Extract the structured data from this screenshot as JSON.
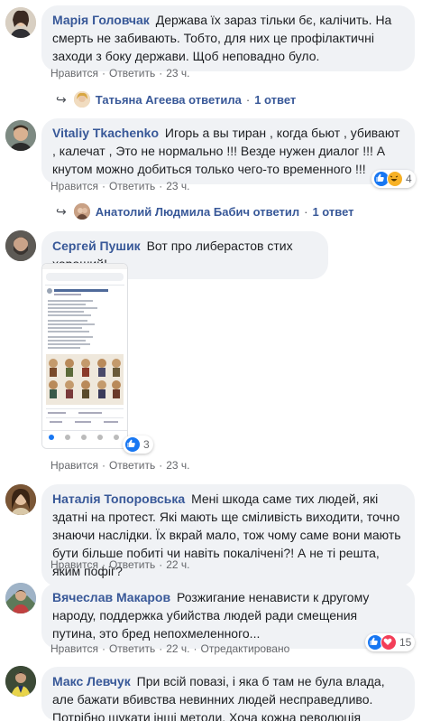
{
  "comments": [
    {
      "author": "Марія Головчак",
      "text": "Держава їх зараз тільки бє, калічить. На смерть не забивають. Тобто, для них це профілактичні заходи з боку держави. Щоб неповадно було.",
      "like": "Нравится",
      "reply": "Ответить",
      "time": "23 ч."
    },
    {
      "author": "Vitaliy Tkachenko",
      "text": "Игорь а вы тиран , когда бьют , убивают , калечат , Это не нормально !!! Везде нужен диалог !!! А кнутом можно добиться только чего-то временного !!!",
      "like": "Нравится",
      "reply": "Ответить",
      "time": "23 ч.",
      "reactions": "4"
    },
    {
      "author": "Сергей Пушик",
      "text": "Вот про либерастов стих хороший!",
      "like": "Нравится",
      "reply": "Ответить",
      "time": "23 ч.",
      "reactions": "3"
    },
    {
      "author": "Наталія Топоровська",
      "text": "Мені шкода саме тих людей, які здатні на протест. Які мають ще сміливість виходити, точно знаючи наслідки. Їх вкрай мало, тож чому саме вони мають бути більше побиті чи навіть покалічені?! А не ті решта, яким пофіг?",
      "like": "Нравится",
      "reply": "Ответить",
      "time": "22 ч."
    },
    {
      "author": "Вячеслав Макаров",
      "text": "Розжигание ненависти к другому народу, поддержка убийства людей ради смещения путина, это бред непохмеленного...",
      "like": "Нравится",
      "reply": "Ответить",
      "time": "22 ч.",
      "edited": "Отредактировано",
      "reactions": "15"
    },
    {
      "author": "Макс Левчук",
      "text": "При всій повазі, і яка б там не була влада, але бажати вбивства невинних людей несправедливо. Потрібно шукати інші методи. Хоча кожна революція потребує жертв."
    }
  ],
  "replies": [
    {
      "name": "Татьяна Агеева ответила",
      "count": "1 ответ"
    },
    {
      "name": "Анатолий Людмила Бабич ответил",
      "count": "1 ответ"
    }
  ],
  "colors": {
    "link": "#385898",
    "bubble": "#f0f2f5",
    "meta": "#65676b",
    "like": "#1877f2"
  }
}
